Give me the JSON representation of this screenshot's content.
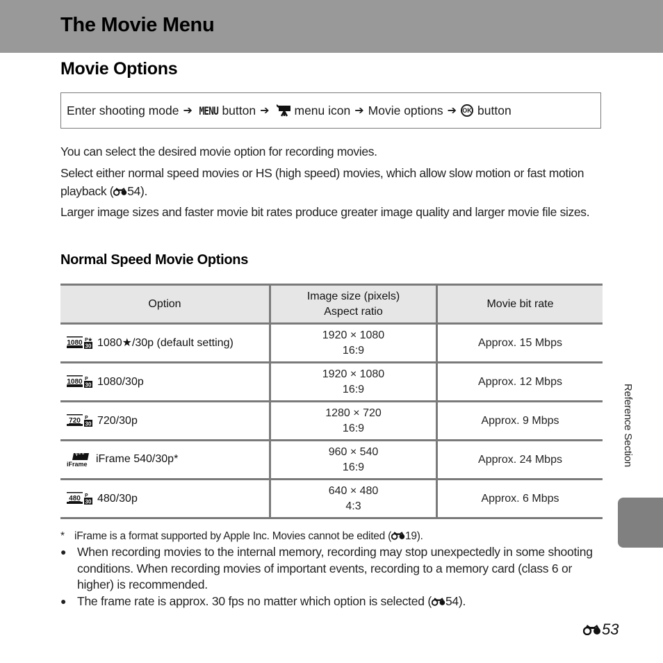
{
  "banner": {
    "title": "The Movie Menu"
  },
  "section_title": "Movie Options",
  "nav_path": {
    "steps": [
      "Enter shooting mode",
      "MENU",
      "button",
      "menu icon",
      "Movie options",
      "button"
    ],
    "icons": [
      "arrow-right-icon",
      "movie-camera-icon",
      "ok-button-icon"
    ],
    "ok_glyph": "OK"
  },
  "paragraphs": [
    "You can select the desired movie option for recording movies.",
    {
      "text": "Select either normal speed movies or HS (high speed) movies, which allow slow motion or fast motion playback (",
      "ref": "54",
      "tail": ")."
    },
    "Larger image sizes and faster movie bit rates produce greater image quality and larger movie file sizes."
  ],
  "subsection_title": "Normal Speed Movie Options",
  "table": {
    "headers": [
      "Option",
      "Image size (pixels)",
      "Aspect ratio",
      "Movie bit rate"
    ],
    "rows": [
      {
        "icon": "1080-star-30p-icon",
        "badge": "1080",
        "option": "1080★/30p (default setting)",
        "size": "1920 × 1080",
        "ratio": "16:9",
        "bitrate": "Approx. 15 Mbps"
      },
      {
        "icon": "1080-30p-icon",
        "badge": "1080",
        "option": "1080/30p",
        "size": "1920 × 1080",
        "ratio": "16:9",
        "bitrate": "Approx. 12 Mbps"
      },
      {
        "icon": "720-30p-icon",
        "badge": "720",
        "option": "720/30p",
        "size": "1280 × 720",
        "ratio": "16:9",
        "bitrate": "Approx. 9 Mbps"
      },
      {
        "icon": "iframe-icon",
        "badge": "iFrame",
        "option": "iFrame 540/30p*",
        "size": "960 × 540",
        "ratio": "16:9",
        "bitrate": "Approx. 24 Mbps"
      },
      {
        "icon": "480-30p-icon",
        "badge": "480",
        "option": "480/30p",
        "size": "640 × 480",
        "ratio": "4:3",
        "bitrate": "Approx. 6 Mbps"
      }
    ]
  },
  "footnotes": {
    "star_mark": "*",
    "star_text": "iFrame is a format supported by Apple Inc. Movies cannot be edited (",
    "star_ref": "19",
    "star_tail": ").",
    "bullets": [
      {
        "text": "When recording movies to the internal memory, recording may stop unexpectedly in some shooting conditions. When recording movies of important events, recording to a memory card (class 6 or higher) is recommended."
      },
      {
        "text": "The frame rate is approx. 30 fps no matter which option is selected (",
        "ref": "54",
        "tail": ")."
      }
    ]
  },
  "side_label": "Reference Section",
  "page_number": "53",
  "colors": {
    "banner": "#999999",
    "table_header": "#e6e6e6",
    "table_border": "#7a7a7a",
    "side_tab": "#808080"
  }
}
